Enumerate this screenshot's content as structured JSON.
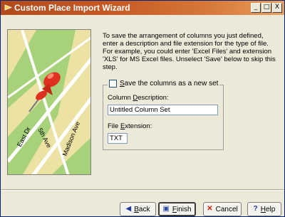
{
  "window": {
    "title": "Custom Place Import Wizard",
    "controls": [
      "_",
      "□",
      "X"
    ]
  },
  "instructions": "To save the arrangement of columns you just defined, enter a description and file extension for the type of file. For example, you could enter 'Excel Files' and extension 'XLS' for MS Excel files. Unselect 'Save' below to skip this step.",
  "save_group": {
    "checkbox_label_prefix": "S",
    "checkbox_label_rest": "ave the columns as a new set",
    "checked": false,
    "description_label_prefix": "Column ",
    "description_label_accel": "D",
    "description_label_rest": "escription:",
    "description_value": "Untitled Column Set",
    "extension_label_prefix": "File ",
    "extension_label_accel": "E",
    "extension_label_rest": "xtension:",
    "extension_value": "TXT"
  },
  "map": {
    "streets": [
      "East Dr",
      "5th Ave",
      "Madison Ave"
    ]
  },
  "buttons": {
    "back_accel": "B",
    "back_rest": "ack",
    "finish_accel": "F",
    "finish_rest": "inish",
    "cancel": "Cancel",
    "help_accel": "H",
    "help_rest": "elp"
  },
  "colors": {
    "titlebar": "#c65a25",
    "map_green": "#a7d27a",
    "map_tan": "#ece2a4",
    "pin_red": "#e03020"
  }
}
